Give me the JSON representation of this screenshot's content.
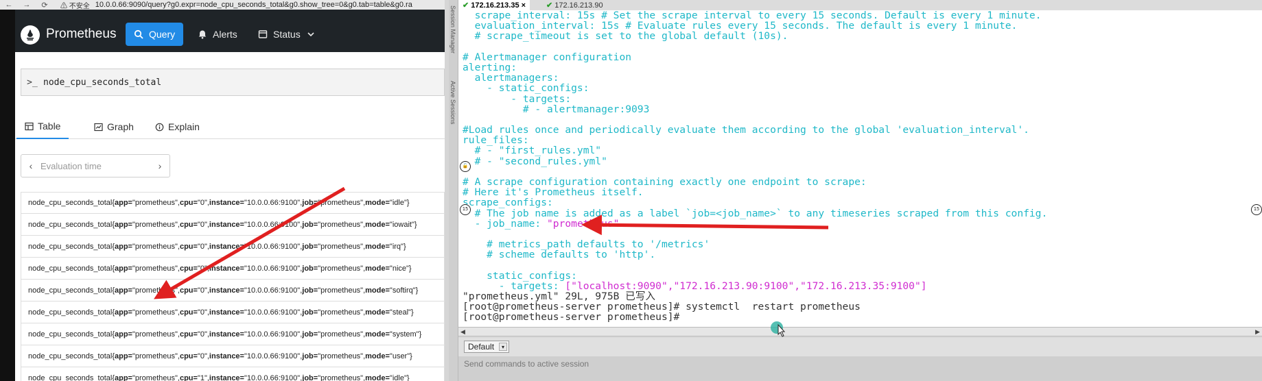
{
  "browser": {
    "nav_back": "←",
    "nav_forward": "→",
    "nav_reload": "⟳",
    "insecure_label": "⚠ 不安全",
    "url": "10.0.0.66:9090/query?g0.expr=node_cpu_seconds_total&g0.show_tree=0&g0.tab=table&g0.ra"
  },
  "prometheus": {
    "brand": "Prometheus",
    "nav": {
      "query": "Query",
      "alerts": "Alerts",
      "status": "Status"
    },
    "expression": "node_cpu_seconds_total",
    "prompt": ">_",
    "tabs": {
      "table": "Table",
      "graph": "Graph",
      "explain": "Explain"
    },
    "eval_time_placeholder": "Evaluation time",
    "eval_prev": "‹",
    "eval_next": "›",
    "rows": [
      {
        "pre": "node_cpu_seconds_total{",
        "app": "app=",
        "app_v": "\"prometheus\", ",
        "cpu": "cpu=",
        "cpu_v": "\"0\", ",
        "inst": "instance=",
        "inst_v": "\"10.0.0.66:9100\", ",
        "job": "job=",
        "job_v": "\"prometheus\", ",
        "mode": "mode=",
        "mode_v": "\"idle\"}"
      },
      {
        "pre": "node_cpu_seconds_total{",
        "app": "app=",
        "app_v": "\"prometheus\", ",
        "cpu": "cpu=",
        "cpu_v": "\"0\", ",
        "inst": "instance=",
        "inst_v": "\"10.0.0.66:9100\", ",
        "job": "job=",
        "job_v": "\"prometheus\", ",
        "mode": "mode=",
        "mode_v": "\"iowait\"}"
      },
      {
        "pre": "node_cpu_seconds_total{",
        "app": "app=",
        "app_v": "\"prometheus\", ",
        "cpu": "cpu=",
        "cpu_v": "\"0\", ",
        "inst": "instance=",
        "inst_v": "\"10.0.0.66:9100\", ",
        "job": "job=",
        "job_v": "\"prometheus\", ",
        "mode": "mode=",
        "mode_v": "\"irq\"}"
      },
      {
        "pre": "node_cpu_seconds_total{",
        "app": "app=",
        "app_v": "\"prometheus\", ",
        "cpu": "cpu=",
        "cpu_v": "\"0\", ",
        "inst": "instance=",
        "inst_v": "\"10.0.0.66:9100\", ",
        "job": "job=",
        "job_v": "\"prometheus\", ",
        "mode": "mode=",
        "mode_v": "\"nice\"}"
      },
      {
        "pre": "node_cpu_seconds_total{",
        "app": "app=",
        "app_v": "\"prometheus\", ",
        "cpu": "cpu=",
        "cpu_v": "\"0\", ",
        "inst": "instance=",
        "inst_v": "\"10.0.0.66:9100\", ",
        "job": "job=",
        "job_v": "\"prometheus\", ",
        "mode": "mode=",
        "mode_v": "\"softirq\"}"
      },
      {
        "pre": "node_cpu_seconds_total{",
        "app": "app=",
        "app_v": "\"prometheus\", ",
        "cpu": "cpu=",
        "cpu_v": "\"0\", ",
        "inst": "instance=",
        "inst_v": "\"10.0.0.66:9100\", ",
        "job": "job=",
        "job_v": "\"prometheus\", ",
        "mode": "mode=",
        "mode_v": "\"steal\"}"
      },
      {
        "pre": "node_cpu_seconds_total{",
        "app": "app=",
        "app_v": "\"prometheus\", ",
        "cpu": "cpu=",
        "cpu_v": "\"0\", ",
        "inst": "instance=",
        "inst_v": "\"10.0.0.66:9100\", ",
        "job": "job=",
        "job_v": "\"prometheus\", ",
        "mode": "mode=",
        "mode_v": "\"system\"}"
      },
      {
        "pre": "node_cpu_seconds_total{",
        "app": "app=",
        "app_v": "\"prometheus\", ",
        "cpu": "cpu=",
        "cpu_v": "\"0\", ",
        "inst": "instance=",
        "inst_v": "\"10.0.0.66:9100\", ",
        "job": "job=",
        "job_v": "\"prometheus\", ",
        "mode": "mode=",
        "mode_v": "\"user\"}"
      },
      {
        "pre": "node_cpu_seconds_total{",
        "app": "app=",
        "app_v": "\"prometheus\", ",
        "cpu": "cpu=",
        "cpu_v": "\"1\", ",
        "inst": "instance=",
        "inst_v": "\"10.0.0.66:9100\", ",
        "job": "job=",
        "job_v": "\"prometheus\", ",
        "mode": "mode=",
        "mode_v": "\"idle\"}"
      }
    ]
  },
  "ssh": {
    "side_labels": {
      "session_manager": "Session Manager",
      "active_sessions": "Active Sessions"
    },
    "tabs": [
      {
        "label": "172.16.213.35",
        "close": "×"
      },
      {
        "label": "172.16.213.90"
      }
    ],
    "tab_check": "✔",
    "terminal": {
      "l1a": "  scrape_interval: 15s # Set the scrape interval to every 15 seconds. Default is every 1 minute.",
      "l2a": "  evaluation_interval: 15s # Evaluate rules every 15 seconds. The default is every 1 minute.",
      "l3a": "  # scrape_timeout is set to the global default (10s).",
      "l4": "",
      "l5": "# Alertmanager configuration",
      "l6": "alerting:",
      "l7": "  alertmanagers:",
      "l8": "    - static_configs:",
      "l9": "        - targets:",
      "l10": "          # - alertmanager:9093",
      "l11": "",
      "l12": "#Load rules once and periodically evaluate them according to the global 'evaluation_interval'.",
      "l13": "rule_files:",
      "l14": "  # - \"first_rules.yml\"",
      "l15": "  # - \"second_rules.yml\"",
      "l16": "",
      "l17": "# A scrape configuration containing exactly one endpoint to scrape:",
      "l18": "# Here it's Prometheus itself.",
      "l19": "scrape_configs:",
      "l20": "  # The job name is added as a label `job=<job_name>` to any timeseries scraped from this config.",
      "l21_key": "  - job_name: ",
      "l21_val": "\"prometheus\"",
      "l22": "",
      "l23": "    # metrics_path defaults to '/metrics'",
      "l24": "    # scheme defaults to 'http'.",
      "l25": "",
      "l26": "    static_configs:",
      "l27_key": "      - targets: ",
      "l27_val": "[\"localhost:9090\",\"172.16.213.90:9100\",\"172.16.213.35:9100\"]",
      "l28": "\"prometheus.yml\" 29L, 975B 已写入",
      "l29": "[root@prometheus-server prometheus]# systemctl  restart prometheus",
      "l30": "[root@prometheus-server prometheus]# "
    },
    "marker_text": "15",
    "scroll_left": "◀",
    "scroll_right": "▶",
    "profile": "Default",
    "profile_arrow": "▾",
    "send_hint": "Send commands to active session"
  },
  "colors": {
    "accent": "#228be6",
    "arrow": "#e02020",
    "terminal_cyan": "#1fb8c8",
    "terminal_magenta": "#d02cd0"
  }
}
